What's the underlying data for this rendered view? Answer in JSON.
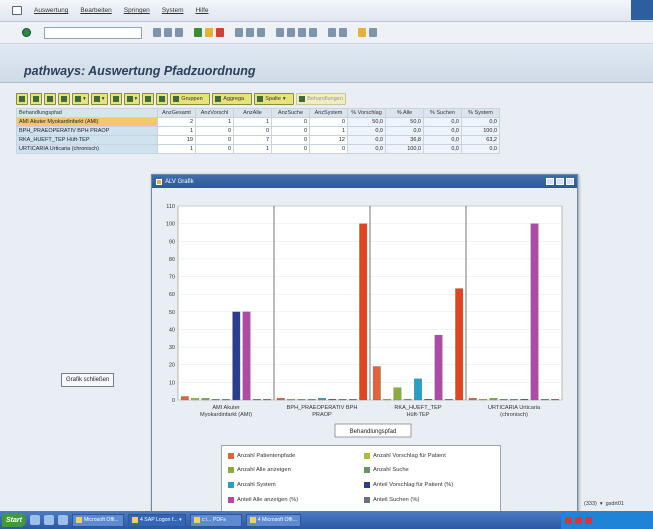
{
  "menu": {
    "items": [
      "Auswertung",
      "Bearbeiten",
      "Springen",
      "System",
      "Hilfe"
    ]
  },
  "title": "pathways: Auswertung Pfadzuordnung",
  "alv_toolbar": {
    "gruppen": "Gruppen",
    "aggrega": "Aggrega",
    "spalte": "Spalte",
    "behandlungen": "Behandlungen"
  },
  "grid": {
    "headers": [
      "Behandlungspfad",
      "AnzGesamt",
      "AnzVorschl",
      "AnzAlle",
      "AnzSuche",
      "AnzSystem",
      "% Vorschlag",
      "% Alle",
      "% Suchen",
      "% System"
    ],
    "rows": [
      {
        "name": "AMI Akuter Myokardinfarkt (AMI)",
        "v": [
          "2",
          "1",
          "1",
          "0",
          "0",
          "50,0",
          "50,0",
          "0,0",
          "0,0"
        ]
      },
      {
        "name": "BPH_PRAEOPERATIV BPH PRAOP",
        "v": [
          "1",
          "0",
          "0",
          "0",
          "1",
          "0,0",
          "0,0",
          "0,0",
          "100,0"
        ]
      },
      {
        "name": "RKA_HUEFT_TEP Hüft-TEP",
        "v": [
          "19",
          "0",
          "7",
          "0",
          "12",
          "0,0",
          "36,8",
          "0,0",
          "63,2"
        ]
      },
      {
        "name": "URTICARIA Urticaria (chronisch)",
        "v": [
          "1",
          "0",
          "1",
          "0",
          "0",
          "0,0",
          "100,0",
          "0,0",
          "0,0"
        ]
      }
    ]
  },
  "close_button": "Grafik schließen",
  "popup": {
    "title": "ALV Grafik",
    "legend": [
      {
        "label": "Anzahl Patientenpfade",
        "color": "#e0643c"
      },
      {
        "label": "Anzahl Vorschlag für Patient",
        "color": "#a3c23a"
      },
      {
        "label": "Anzahl Alle anzeigen",
        "color": "#8aae3c"
      },
      {
        "label": "Anzahl Suche",
        "color": "#5f9a5f"
      },
      {
        "label": "Anzahl System",
        "color": "#27a0c9"
      },
      {
        "label": "Anteil Vorschlag für Patient (%)",
        "color": "#2b3d8f"
      },
      {
        "label": "Anteil Alle anzeigen (%)",
        "color": "#b04aa8"
      },
      {
        "label": "Anteil Suchen (%)",
        "color": "#6a7280"
      },
      {
        "label": "Anteil System (%)",
        "color": "#e2451f"
      }
    ]
  },
  "chart_data": {
    "type": "bar",
    "xlabel": "Behandlungspfad",
    "ylim": [
      0,
      110
    ],
    "yticks": [
      0,
      10,
      20,
      30,
      40,
      50,
      60,
      70,
      80,
      90,
      100,
      110
    ],
    "categories": [
      "AMI Akuter Myokardinfarkt (AMI)",
      "BPH_PRAEOPERATIV BPH PRAOP",
      "RKA_HUEFT_TEP Hüft-TEP",
      "URTICARIA Urticaria (chronisch)"
    ],
    "series": [
      {
        "name": "Anzahl Patientenpfade",
        "color": "#e0643c",
        "values": [
          2,
          1,
          19,
          1
        ]
      },
      {
        "name": "Anzahl Vorschlag für Patient",
        "color": "#a3c23a",
        "values": [
          1,
          0,
          0,
          0
        ]
      },
      {
        "name": "Anzahl Alle anzeigen",
        "color": "#8aae3c",
        "values": [
          1,
          0,
          7,
          1
        ]
      },
      {
        "name": "Anzahl Suche",
        "color": "#5f9a5f",
        "values": [
          0,
          0,
          0,
          0
        ]
      },
      {
        "name": "Anzahl System",
        "color": "#27a0c9",
        "values": [
          0,
          1,
          12,
          0
        ]
      },
      {
        "name": "Anteil Vorschlag für Patient (%)",
        "color": "#2b3d8f",
        "values": [
          50,
          0,
          0,
          0
        ]
      },
      {
        "name": "Anteil Alle anzeigen (%)",
        "color": "#b04aa8",
        "values": [
          50,
          0,
          36.8,
          100
        ]
      },
      {
        "name": "Anteil Suchen (%)",
        "color": "#6a7280",
        "values": [
          0,
          0,
          0,
          0
        ]
      },
      {
        "name": "Anteil System (%)",
        "color": "#e2451f",
        "values": [
          0,
          100,
          63.2,
          0
        ]
      }
    ]
  },
  "footer": {
    "status": "(333)",
    "host": "gsdrt01"
  },
  "taskbar": {
    "start": "Start",
    "tasks": [
      "Microsoft Offi...",
      "4 SAP Logon f... ▾",
      "c:\\... PDFs",
      "4 Microsoft Offi..."
    ]
  }
}
